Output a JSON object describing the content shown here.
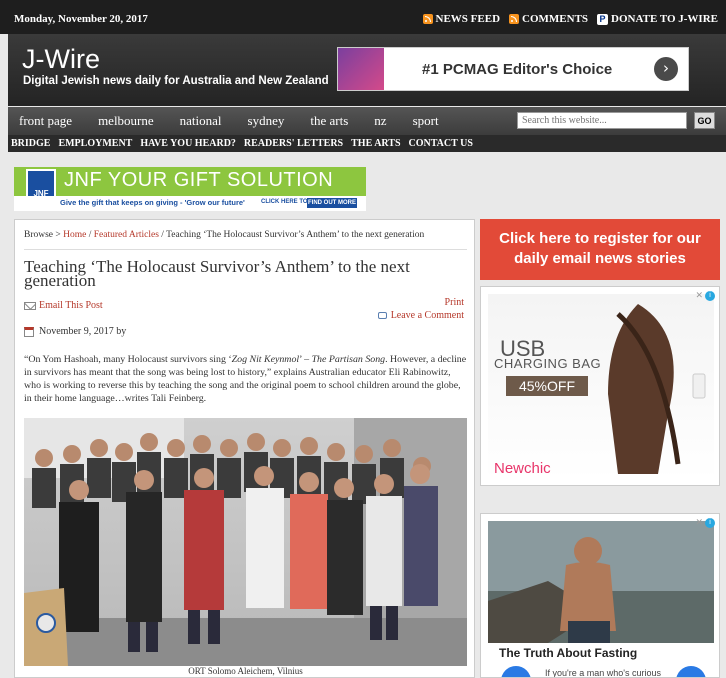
{
  "topbar": {
    "date": "Monday, November 20, 2017",
    "links": [
      "NEWS FEED",
      "COMMENTS",
      "DONATE TO J-WIRE"
    ]
  },
  "header": {
    "title": "J-Wire",
    "tagline": "Digital Jewish news daily for Australia and New Zealand",
    "ad_text": "#1 PCMAG Editor's Choice"
  },
  "nav_primary": [
    "front page",
    "melbourne",
    "national",
    "sydney",
    "the arts",
    "nz",
    "sport"
  ],
  "search": {
    "placeholder": "Search this website...",
    "button": "GO"
  },
  "nav_secondary": [
    "BRIDGE",
    "EMPLOYMENT",
    "HAVE YOU HEARD?",
    "READERS' LETTERS",
    "THE ARTS",
    "CONTACT US"
  ],
  "banner": {
    "headline": "JNF YOUR GIFT SOLUTION",
    "logo": "JNF",
    "strip_text": "Give the gift that keeps on giving - 'Grow our future'",
    "click_text": "CLICK HERE TO",
    "button": "FIND OUT MORE"
  },
  "breadcrumb": {
    "prefix": "Browse >",
    "home": "Home",
    "sep": "/",
    "section": "Featured Articles",
    "current": "Teaching ‘The Holocaust Survivor’s Anthem’ to the next generation"
  },
  "post": {
    "title": "Teaching ‘The Holocaust Survivor’s Anthem’ to the next generation",
    "email": "Email This Post",
    "print": "Print",
    "leave_comment": "Leave a Comment",
    "date_by": "November 9, 2017 by",
    "excerpt_1": "“On Yom Hashoah, many Holocaust survivors sing ‘",
    "excerpt_song": "Zog Nit Keynmol",
    "excerpt_2": "’ – ",
    "excerpt_song2": "The Partisan Song",
    "excerpt_3": ". However, a decline in survivors has meant that the song was being lost to history,” explains Australian educator Eli Rabinowitz, who is working to reverse this by teaching the song and the original poem to school children around the globe, in their home language…writes Tali Feinberg.",
    "caption": "ORT Solomo Aleichem, Vilnius"
  },
  "sidebar": {
    "register": "Click here to register for our daily email news stories",
    "ad1": {
      "line1": "USB",
      "line2": "CHARGING BAG",
      "discount": "45%OFF",
      "brand": "Newchic"
    },
    "ad2": {
      "title": "The Truth About Fasting",
      "sub": "If you're a man who's curious"
    }
  }
}
